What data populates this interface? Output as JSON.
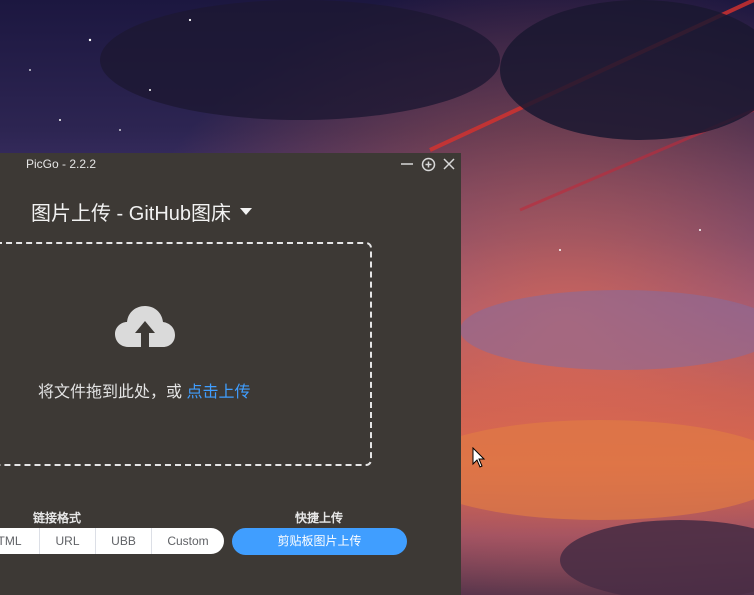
{
  "window": {
    "title": "PicGo - 2.2.2"
  },
  "header": {
    "title": "图片上传 - GitHub图床"
  },
  "dropzone": {
    "text": "将文件拖到此处，或",
    "link": "点击上传"
  },
  "link_format": {
    "label": "链接格式",
    "options": [
      "TML",
      "URL",
      "UBB",
      "Custom"
    ]
  },
  "quick_upload": {
    "label": "快捷上传",
    "button": "剪贴板图片上传"
  },
  "colors": {
    "window_bg": "#3d3935",
    "accent": "#409eff"
  }
}
